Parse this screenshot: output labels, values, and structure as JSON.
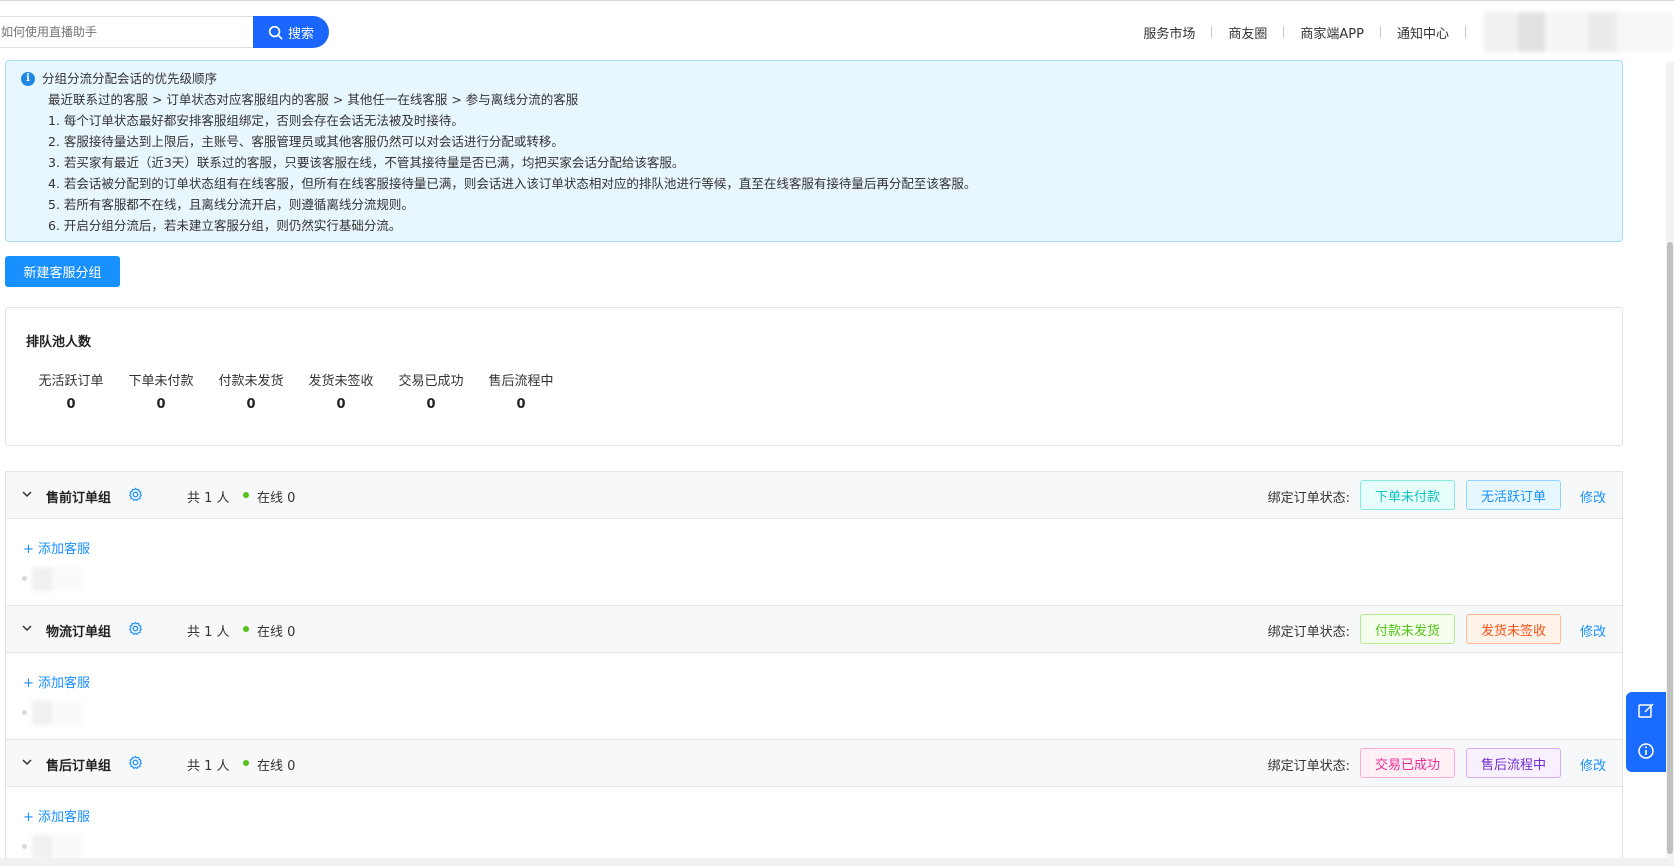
{
  "header": {
    "search_placeholder": "如何使用直播助手",
    "search_button": "搜索",
    "nav": [
      "服务市场",
      "商友圈",
      "商家端APP",
      "通知中心"
    ]
  },
  "notice": {
    "title": "分组分流分配会话的优先级顺序",
    "order": "最近联系过的客服 > 订单状态对应客服组内的客服 >  其他任一在线客服 > 参与离线分流的客服",
    "items": [
      "1. 每个订单状态最好都安排客服组绑定，否则会存在会话无法被及时接待。",
      "2. 客服接待量达到上限后，主账号、客服管理员或其他客服仍然可以对会话进行分配或转移。",
      "3. 若买家有最近（近3天）联系过的客服，只要该客服在线，不管其接待量是否已满，均把买家会话分配给该客服。",
      "4. 若会话被分配到的订单状态组有在线客服，但所有在线客服接待量已满，则会话进入该订单状态相对应的排队池进行等候，直至在线客服有接待量后再分配至该客服。",
      "5.  若所有客服都不在线，且离线分流开启，则遵循离线分流规则。",
      "6. 开启分组分流后，若未建立客服分组，则仍然实行基础分流。"
    ]
  },
  "new_group_button": "新建客服分组",
  "queue": {
    "title": "排队池人数",
    "stats": [
      {
        "label": "无活跃订单",
        "value": "0"
      },
      {
        "label": "下单未付款",
        "value": "0"
      },
      {
        "label": "付款未发货",
        "value": "0"
      },
      {
        "label": "发货未签收",
        "value": "0"
      },
      {
        "label": "交易已成功",
        "value": "0"
      },
      {
        "label": "售后流程中",
        "value": "0"
      }
    ]
  },
  "groups": [
    {
      "name": "售前订单组",
      "count": "共 1 人",
      "online": "在线 0",
      "bind_label": "绑定订单状态:",
      "tags": [
        {
          "text": "下单未付款",
          "color": "#13c2c2",
          "bg": "#e6fffb",
          "border": "#87e8de"
        },
        {
          "text": "无活跃订单",
          "color": "#1890ff",
          "bg": "#e6f7ff",
          "border": "#91d5ff"
        }
      ],
      "edit": "修改",
      "add_agent": "+ 添加客服"
    },
    {
      "name": "物流订单组",
      "count": "共 1 人",
      "online": "在线 0",
      "bind_label": "绑定订单状态:",
      "tags": [
        {
          "text": "付款未发货",
          "color": "#52c41a",
          "bg": "#f6ffed",
          "border": "#b7eb8f"
        },
        {
          "text": "发货未签收",
          "color": "#fa541c",
          "bg": "#fff2e8",
          "border": "#ffbb96"
        }
      ],
      "edit": "修改",
      "add_agent": "+ 添加客服"
    },
    {
      "name": "售后订单组",
      "count": "共 1 人",
      "online": "在线 0",
      "bind_label": "绑定订单状态:",
      "tags": [
        {
          "text": "交易已成功",
          "color": "#eb2f96",
          "bg": "#fff0f6",
          "border": "#ffadd2"
        },
        {
          "text": "售后流程中",
          "color": "#722ed1",
          "bg": "#f9f0ff",
          "border": "#d3adf7"
        }
      ],
      "edit": "修改",
      "add_agent": "+ 添加客服"
    }
  ],
  "floating_icons": [
    "edit-icon",
    "info-icon"
  ],
  "colors": {
    "accent": "#1890ff",
    "search": "#1a66ff",
    "online": "#52c41a",
    "notice_bg": "#e8f6fd"
  }
}
